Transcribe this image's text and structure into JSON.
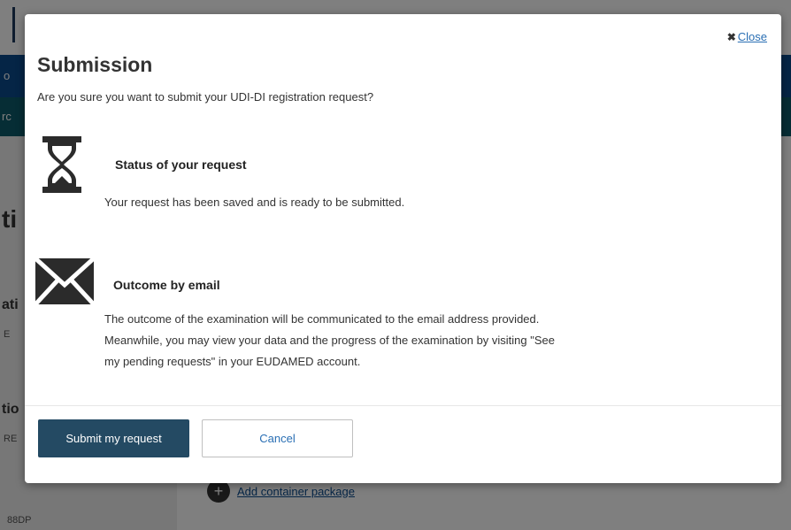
{
  "background": {
    "nav_fragment_1": "o",
    "nav_fragment_2": "rc",
    "heading_fragment_1": "ti",
    "heading_fragment_2": "ati",
    "heading_fragment_3": "tio",
    "side_fragment_1": "E",
    "side_fragment_2": "RE",
    "footer_fragment": "88DP",
    "add_link_label": "Add container package",
    "add_icon": "plus-icon"
  },
  "modal": {
    "close_label": "Close",
    "close_icon": "close-icon",
    "title": "Submission",
    "question": "Are you sure you want to submit your UDI-DI registration request?",
    "status": {
      "icon": "hourglass-icon",
      "heading": "Status of your request",
      "text": "Your request has been saved and is ready to be submitted."
    },
    "outcome": {
      "icon": "envelope-icon",
      "heading": "Outcome by email",
      "line1": "The outcome of the examination will be communicated to the email address provided.",
      "line2": "Meanwhile, you may view your data and the progress of the examination by visiting \"See",
      "line3": "my pending requests\" in your EUDAMED account."
    },
    "buttons": {
      "submit": "Submit my request",
      "cancel": "Cancel"
    }
  },
  "colors": {
    "primary_button": "#244a63",
    "link": "#2a6fb4",
    "nav_blue": "#0b4a8c"
  }
}
